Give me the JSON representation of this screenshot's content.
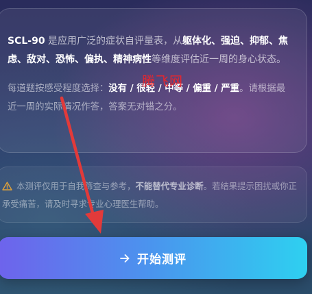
{
  "intro": {
    "s1": "SCL-90",
    "s2": " 是应用广泛的症状自评量表，从",
    "s3": "躯体化、强迫、抑郁、焦虑、敌对、恐怖、偏执、精神病性",
    "s4": "等维度评估近一周的身心状态。"
  },
  "hint": {
    "s1": "每道题按感受程度选择：",
    "s2": "没有 / 很轻 / 中等 / 偏重 / 严重",
    "s3": "。请根据最近一周的实际情况作答，答案无对错之分。"
  },
  "notice": {
    "s1": "本测评仅用于自我筛查与参考，",
    "s2": "不能替代专业诊断",
    "s3": "。若结果提示困扰或你正承受痛苦，请及时寻求专业心理医生帮助。"
  },
  "start_button": {
    "label": "开始测评"
  },
  "watermark": {
    "text": "腾飞网"
  },
  "colors": {
    "button_gradient_start": "#6e63ec",
    "button_gradient_end": "#2ed0f0",
    "warning_icon": "#e0a23a",
    "annotation_arrow": "#e23a3a",
    "watermark": "#e8262d"
  },
  "icons": {
    "notice": "warning-triangle-icon",
    "start_button": "arrow-right-icon"
  }
}
